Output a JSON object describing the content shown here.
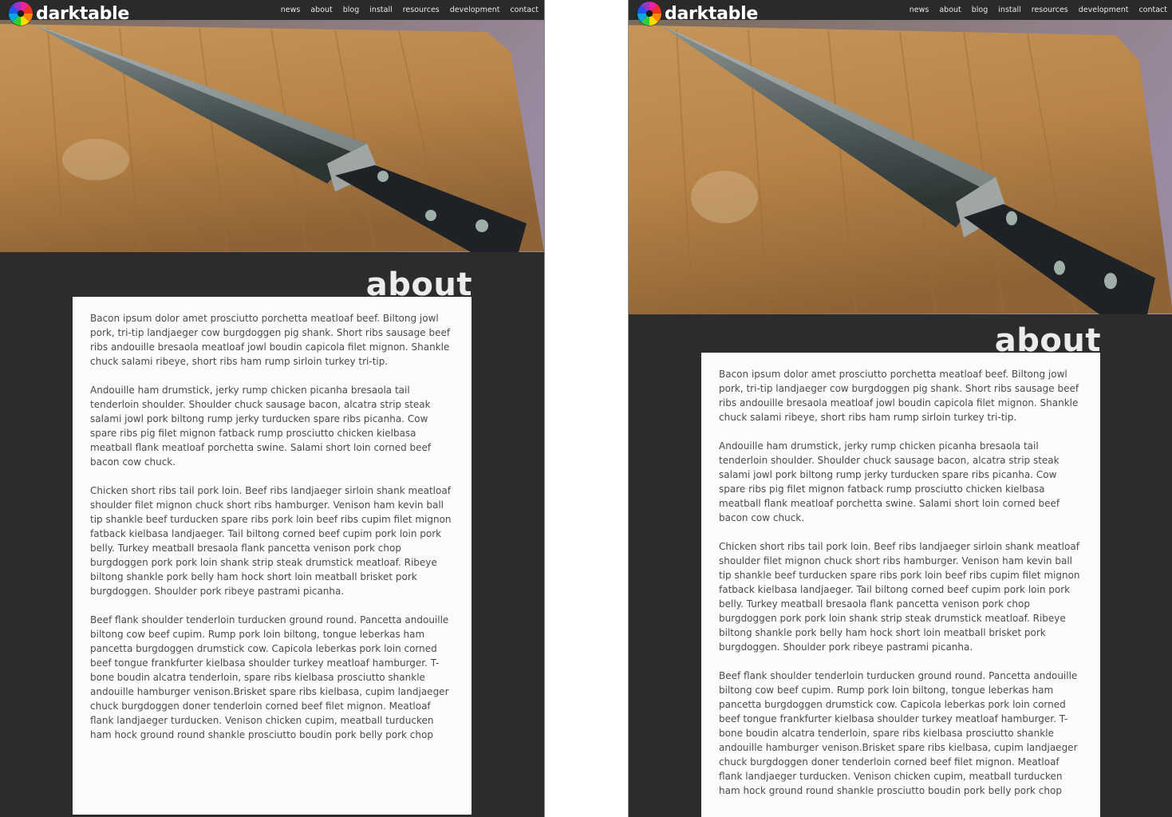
{
  "brand": "darktable",
  "nav": [
    "news",
    "about",
    "blog",
    "install",
    "resources",
    "development",
    "contact"
  ],
  "page_title": "about",
  "paragraphs": [
    "Bacon ipsum dolor amet prosciutto porchetta meatloaf beef. Biltong jowl pork, tri-tip landjaeger cow burgdoggen pig shank. Short ribs sausage beef ribs andouille bresaola meatloaf jowl boudin capicola filet mignon. Shankle chuck salami ribeye, short ribs ham rump sirloin turkey tri-tip.",
    "Andouille ham drumstick, jerky rump chicken picanha bresaola tail tenderloin shoulder. Shoulder chuck sausage bacon, alcatra strip steak salami jowl pork biltong rump jerky turducken spare ribs picanha. Cow spare ribs pig filet mignon fatback rump prosciutto chicken kielbasa meatball flank meatloaf porchetta swine. Salami short loin corned beef bacon cow chuck.",
    "Chicken short ribs tail pork loin. Beef ribs landjaeger sirloin shank meatloaf shoulder filet mignon chuck short ribs hamburger. Venison ham kevin ball tip shankle beef turducken spare ribs pork loin beef ribs cupim filet mignon fatback kielbasa landjaeger. Tail biltong corned beef cupim pork loin pork belly. Turkey meatball bresaola flank pancetta venison pork chop burgdoggen pork pork loin shank strip steak drumstick meatloaf. Ribeye biltong shankle pork belly ham hock short loin meatball brisket pork burgdoggen. Shoulder pork ribeye pastrami picanha.",
    "Beef flank shoulder tenderloin turducken ground round. Pancetta andouille biltong cow beef cupim. Rump pork loin biltong, tongue leberkas ham pancetta burgdoggen drumstick cow. Capicola leberkas pork loin corned beef tongue frankfurter kielbasa shoulder turkey meatloaf hamburger. T-bone boudin alcatra tenderloin, spare ribs kielbasa prosciutto shankle andouille hamburger venison.Brisket spare ribs kielbasa, cupim landjaeger chuck burgdoggen doner tenderloin corned beef filet mignon. Meatloaf flank landjaeger turducken. Venison chicken cupim, meatball turducken ham hock ground round shankle prosciutto boudin pork belly pork chop"
  ],
  "hero_image": "knife-on-cutting-board",
  "logo_icon": "darktable-aperture-icon",
  "colors": {
    "page_bg": "#2c2c2c",
    "topbar_bg": "#2a2a2a",
    "content_bg": "#fbfbfb",
    "body_text": "#4a4a4a",
    "heading_text": "#ececec"
  }
}
